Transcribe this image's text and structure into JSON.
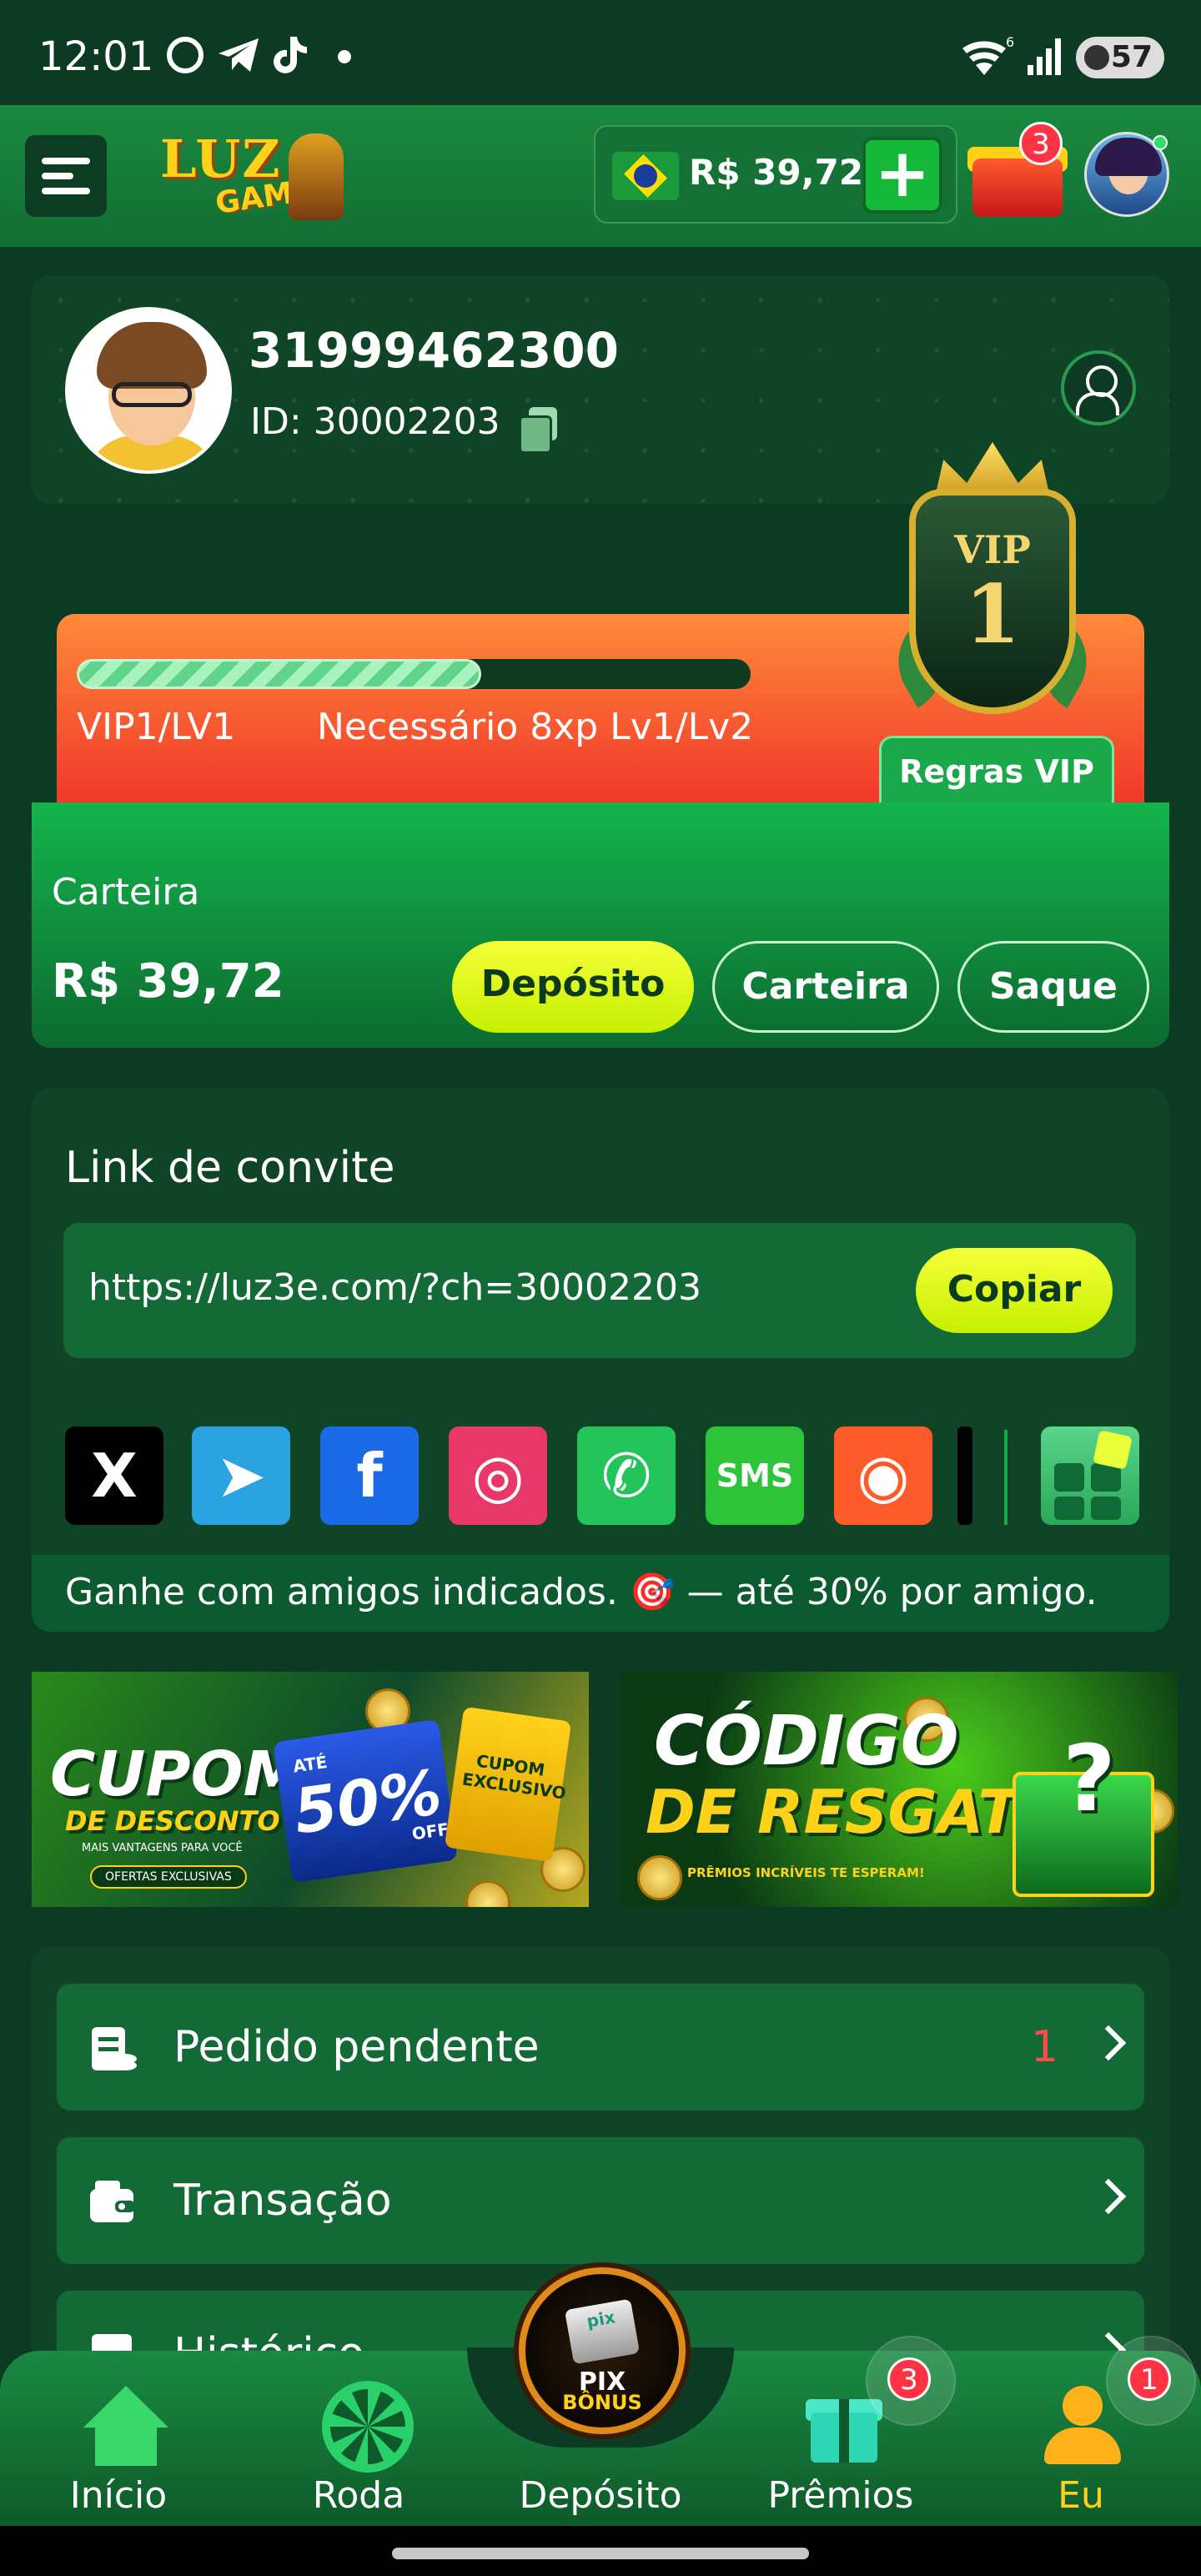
{
  "status_bar": {
    "time": "12:01",
    "wifi_label": "6",
    "battery": "57",
    "icons": [
      "chrome-icon",
      "telegram-icon",
      "tiktok-icon"
    ]
  },
  "header": {
    "logo_line1": "LUZ",
    "logo_line2": "GAMES",
    "balance": "R$ 39,72",
    "add_symbol": "+",
    "gift_badge": "3"
  },
  "profile": {
    "phone": "31999462300",
    "id_text": "ID: 30002203"
  },
  "vip": {
    "badge_label": "VIP",
    "badge_level": "1",
    "progress_fraction": 0.6,
    "level_text": "VIP1/LV1",
    "requirement_text": "Necessário 8xp Lv1/Lv2",
    "rules_button": "Regras VIP"
  },
  "wallet": {
    "title": "Carteira",
    "amount": "R$ 39,72",
    "buttons": {
      "deposit": "Depósito",
      "wallet": "Carteira",
      "withdraw": "Saque"
    }
  },
  "invite": {
    "title": "Link de convite",
    "url": "https://luz3e.com/?ch=30002203",
    "copy_button": "Copiar",
    "share_targets": [
      {
        "name": "x-icon",
        "glyph": "X",
        "color": "#000000"
      },
      {
        "name": "telegram-icon",
        "glyph": "➤",
        "color": "#2aa3e0"
      },
      {
        "name": "facebook-icon",
        "glyph": "f",
        "color": "#1a6ae8"
      },
      {
        "name": "instagram-icon",
        "glyph": "◎",
        "color": "#e8386a"
      },
      {
        "name": "whatsapp-icon",
        "glyph": "✆",
        "color": "#23c45a"
      },
      {
        "name": "sms-icon",
        "glyph": "SMS",
        "color": "#2ec43a"
      },
      {
        "name": "kwai-icon",
        "glyph": "◉",
        "color": "#ff5a2a"
      }
    ],
    "footer_text": "Ganhe com amigos indicados. 🎯 — até 30% por amigo."
  },
  "banners": {
    "coupon": {
      "line1": "CUPOM",
      "line2": "DE DESCONTO",
      "percent": "50%",
      "off": "OFF",
      "ate": "ATÉ",
      "small": "MAIS VANTAGENS PARA VOCÊ",
      "pill": "OFERTAS EXCLUSIVAS",
      "ticket": "CUPOM EXCLUSIVO"
    },
    "redeem": {
      "line1": "CÓDIGO",
      "line2": "DE RESGATE",
      "small": "PRÊMIOS INCRÍVEIS TE ESPERAM!",
      "mark": "?"
    }
  },
  "menu": [
    {
      "label": "Pedido pendente",
      "count": "1"
    },
    {
      "label": "Transação",
      "count": ""
    },
    {
      "label": "Histórico",
      "count": ""
    }
  ],
  "bottom_nav": {
    "items": [
      {
        "label": "Início"
      },
      {
        "label": "Roda"
      },
      {
        "label": "Depósito"
      },
      {
        "label": "Prêmios"
      },
      {
        "label": "Eu"
      }
    ],
    "pix_line1": "PIX",
    "pix_line2": "BÔNUS",
    "pix_brand": "pix",
    "premios_badge": "3",
    "eu_badge": "1",
    "active": "Eu"
  }
}
